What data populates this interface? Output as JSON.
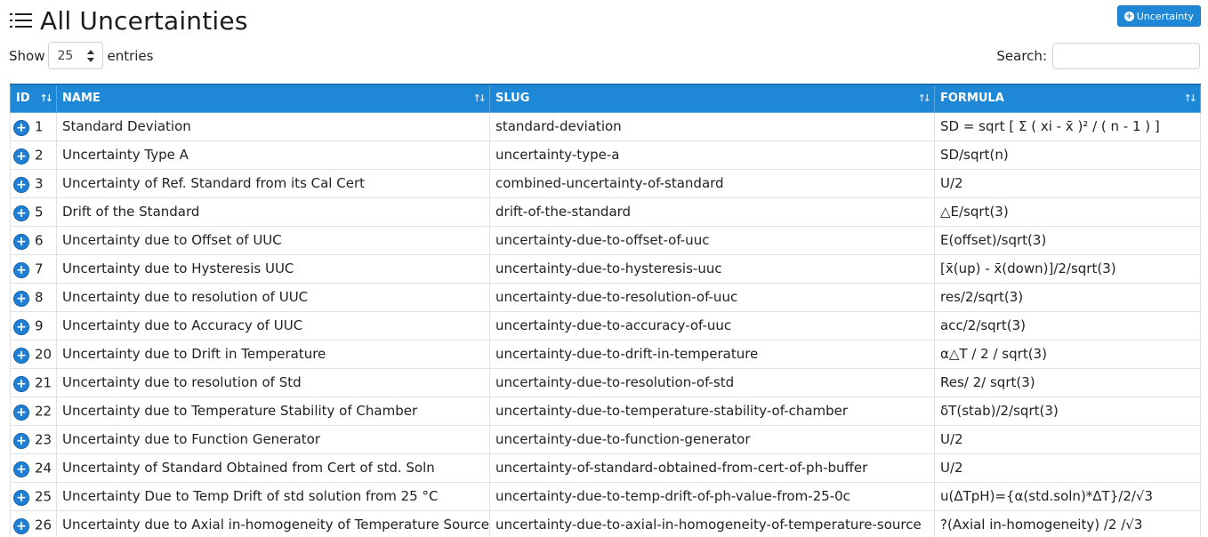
{
  "header": {
    "title": "All Uncertainties",
    "add_button_label": "Uncertainty"
  },
  "length": {
    "show_label": "Show",
    "selected": "25",
    "entries_label": "entries"
  },
  "search": {
    "label": "Search:",
    "value": ""
  },
  "table": {
    "columns": [
      "ID",
      "NAME",
      "SLUG",
      "FORMULA"
    ],
    "rows": [
      {
        "id": "1",
        "name": "Standard Deviation",
        "slug": "standard-deviation",
        "formula": "SD = sqrt [ Σ ( xi - x̄ )² / ( n - 1 ) ]"
      },
      {
        "id": "2",
        "name": "Uncertainty Type A",
        "slug": "uncertainty-type-a",
        "formula": "SD/sqrt(n)"
      },
      {
        "id": "3",
        "name": "Uncertainty of Ref. Standard from its Cal Cert",
        "slug": "combined-uncertainty-of-standard",
        "formula": "U/2"
      },
      {
        "id": "5",
        "name": "Drift of the Standard",
        "slug": "drift-of-the-standard",
        "formula": "△E/sqrt(3)"
      },
      {
        "id": "6",
        "name": "Uncertainty due to Offset of UUC",
        "slug": "uncertainty-due-to-offset-of-uuc",
        "formula": "E(offset)/sqrt(3)"
      },
      {
        "id": "7",
        "name": "Uncertainty due to Hysteresis UUC",
        "slug": "uncertainty-due-to-hysteresis-uuc",
        "formula": "[x̄(up) - x̄(down)]/2/sqrt(3)"
      },
      {
        "id": "8",
        "name": "Uncertainty due to resolution of UUC",
        "slug": "uncertainty-due-to-resolution-of-uuc",
        "formula": "res/2/sqrt(3)"
      },
      {
        "id": "9",
        "name": "Uncertainty due to Accuracy of UUC",
        "slug": "uncertainty-due-to-accuracy-of-uuc",
        "formula": "acc/2/sqrt(3)"
      },
      {
        "id": "20",
        "name": "Uncertainty due to Drift in Temperature",
        "slug": "uncertainty-due-to-drift-in-temperature",
        "formula": "α△T / 2 / sqrt(3)"
      },
      {
        "id": "21",
        "name": "Uncertainty due to resolution of Std",
        "slug": "uncertainty-due-to-resolution-of-std",
        "formula": "Res/ 2/ sqrt(3)"
      },
      {
        "id": "22",
        "name": "Uncertainty due to Temperature Stability of Chamber",
        "slug": "uncertainty-due-to-temperature-stability-of-chamber",
        "formula": "δT(stab)/2/sqrt(3)"
      },
      {
        "id": "23",
        "name": "Uncertainty due to Function Generator",
        "slug": "uncertainty-due-to-function-generator",
        "formula": "U/2"
      },
      {
        "id": "24",
        "name": "Uncertainty of Standard Obtained from Cert of std. Soln",
        "slug": "uncertainty-of-standard-obtained-from-cert-of-ph-buffer",
        "formula": "U/2"
      },
      {
        "id": "25",
        "name": "Uncertainty Due to Temp Drift of std solution from 25 °C",
        "slug": "uncertainty-due-to-temp-drift-of-ph-value-from-25-0c",
        "formula": "u(ΔTpH)={α(std.soln)*ΔT}/2/√3"
      },
      {
        "id": "26",
        "name": "Uncertainty due to Axial in-homogeneity of Temperature Source",
        "slug": "uncertainty-due-to-axial-in-homogeneity-of-temperature-source",
        "formula": "?(Axial in-homogeneity) /2 /√3"
      }
    ]
  }
}
